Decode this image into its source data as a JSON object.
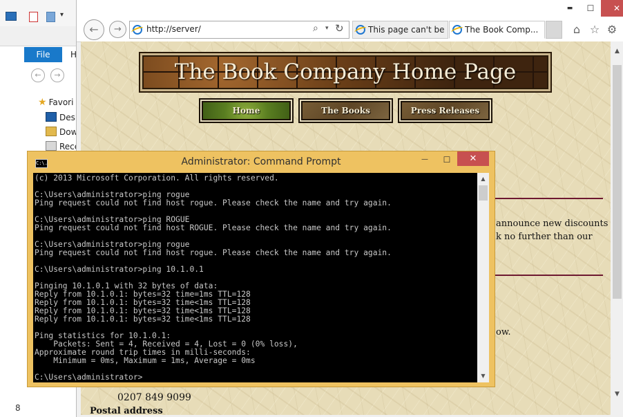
{
  "explorer": {
    "file_tab": "File",
    "home_tab": "H",
    "tree_items": [
      {
        "label": "Favori",
        "icon": "star-icon"
      },
      {
        "label": "Desk",
        "icon": "desktop-icon"
      },
      {
        "label": "Dow",
        "icon": "downloads-icon"
      },
      {
        "label": "Rece",
        "icon": "recent-places-icon"
      }
    ],
    "status_fragment": "8"
  },
  "browser": {
    "address": "http://server/",
    "tabs": [
      {
        "label": "This page can't be ...",
        "active": false
      },
      {
        "label": "The Book Comp...",
        "active": true
      }
    ],
    "window_controls": {
      "minimize": "▬",
      "maximize": "☐",
      "close": "✕"
    }
  },
  "page": {
    "banner_title": "The Book Company Home Page",
    "nav": [
      {
        "label": "Home"
      },
      {
        "label": "The Books"
      },
      {
        "label": "Press Releases"
      }
    ],
    "text_fragments": [
      "announce  new discounts",
      "k no further than our",
      "ow.",
      "0207 849 9099",
      "Postal address"
    ]
  },
  "cmd": {
    "title": "Administrator: Command Prompt",
    "icon_text": "C:\\.",
    "window_controls": {
      "minimize": "—",
      "maximize": "☐",
      "close": "✕"
    },
    "lines": [
      "(c) 2013 Microsoft Corporation. All rights reserved.",
      "",
      "C:\\Users\\administrator>ping rogue",
      "Ping request could not find host rogue. Please check the name and try again.",
      "",
      "C:\\Users\\administrator>ping ROGUE",
      "Ping request could not find host ROGUE. Please check the name and try again.",
      "",
      "C:\\Users\\administrator>ping rogue",
      "Ping request could not find host rogue. Please check the name and try again.",
      "",
      "C:\\Users\\administrator>ping 10.1.0.1",
      "",
      "Pinging 10.1.0.1 with 32 bytes of data:",
      "Reply from 10.1.0.1: bytes=32 time=1ms TTL=128",
      "Reply from 10.1.0.1: bytes=32 time<1ms TTL=128",
      "Reply from 10.1.0.1: bytes=32 time<1ms TTL=128",
      "Reply from 10.1.0.1: bytes=32 time<1ms TTL=128",
      "",
      "Ping statistics for 10.1.0.1:",
      "    Packets: Sent = 4, Received = 4, Lost = 0 (0% loss),",
      "Approximate round trip times in milli-seconds:",
      "    Minimum = 0ms, Maximum = 1ms, Average = 0ms",
      "",
      "C:\\Users\\administrator>"
    ]
  },
  "colors": {
    "window_frame": "#e9b33c",
    "close_button": "#c75050",
    "accent_blue": "#1979ca",
    "page_rule": "#6d1830"
  }
}
